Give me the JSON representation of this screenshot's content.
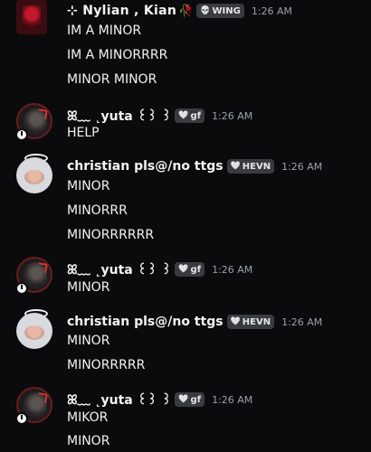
{
  "groups": [
    {
      "author": "⊹ Nylian , Kian",
      "author_emoji": "🥀",
      "tag": {
        "icon": "💀",
        "label": "WING"
      },
      "time": "1:26 AM",
      "lines": [
        "IM A MINOR",
        "IM A MINORRRR",
        "MINOR MINOR"
      ]
    },
    {
      "author": "ꕤ﹏ ˛yuta ꒰꒱ ꒱",
      "tag": {
        "icon": "🤍",
        "label": "gf"
      },
      "time": "1:26 AM",
      "lines": [
        "HELP"
      ]
    },
    {
      "author": "christian pls@/no ttgs",
      "tag": {
        "icon": "🤍",
        "label": "HEVN"
      },
      "time": "1:26 AM",
      "lines": [
        "MINOR",
        "MINORRR",
        "MINORRRRRR"
      ]
    },
    {
      "author": "ꕤ﹏ ˛yuta ꒰꒱ ꒱",
      "tag": {
        "icon": "🤍",
        "label": "gf"
      },
      "time": "1:26 AM",
      "lines": [
        "MINOR"
      ]
    },
    {
      "author": "christian pls@/no ttgs",
      "tag": {
        "icon": "🤍",
        "label": "HEVN"
      },
      "time": "1:26 AM",
      "lines": [
        "MINOR",
        "MINORRRRR"
      ]
    },
    {
      "author": "ꕤ﹏ ˛yuta ꒰꒱ ꒱",
      "tag": {
        "icon": "🤍",
        "label": "gf"
      },
      "time": "1:26 AM",
      "lines": [
        "MIKOR",
        "MINOR"
      ]
    }
  ]
}
